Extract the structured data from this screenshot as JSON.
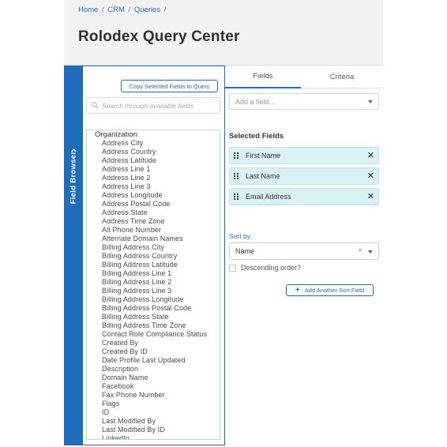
{
  "breadcrumb": {
    "items": [
      "Home",
      "CRM",
      "Queries"
    ],
    "separator": "/"
  },
  "page_title": "Rolodex Query Center",
  "field_browser": {
    "rail_label": "Field Browser",
    "copy_button_label": "Copy Selected Fields to Query",
    "search_placeholder": "Search through available fields",
    "group_name": "Organization",
    "items": [
      "Address City",
      "Address Country",
      "Address Latitude",
      "Address Line 1",
      "Address Line 2",
      "Address Line 3",
      "Address Longitude",
      "Address Postal Code",
      "Address State",
      "Address Time Zone",
      "Alt Phone Number",
      "Alternate Domain Names",
      "Billing Address City",
      "Billing Address Country",
      "Billing Address Latitude",
      "Billing Address Line 1",
      "Billing Address Line 2",
      "Billing Address Line 3",
      "Billing Address Longitude",
      "Billing Address Postal Code",
      "Billing Address State",
      "Billing Address Time Zone",
      "Contact Role Compliance Status",
      "Created By",
      "Created By ID",
      "Date Profile Last Updated",
      "Description",
      "Domain Name",
      "Facebook",
      "Fax Phone Number",
      "Flags",
      "ID",
      "Last Modified By",
      "Last Modified By ID",
      "LinkedIn"
    ]
  },
  "tabs": {
    "fields": "Fields",
    "criteria": "Criteria",
    "active": "Fields"
  },
  "add_field": {
    "placeholder": "Add a field..."
  },
  "selected_fields": {
    "title": "Selected Fields",
    "items": [
      "First Name",
      "Last Name",
      "Email Address"
    ],
    "remove_glyph": "✕"
  },
  "sort": {
    "label": "Sort by:",
    "value": "Name",
    "clear_glyph": "×",
    "descending_label": "Descending order?",
    "descending_checked": false,
    "add_button_label": "Add Another Sort Field",
    "add_button_icon": "+"
  },
  "colors": {
    "accent": "#1f6dbf",
    "selected_field_bg": "#d8f1f5",
    "page_bg": "#f2f2f2"
  }
}
